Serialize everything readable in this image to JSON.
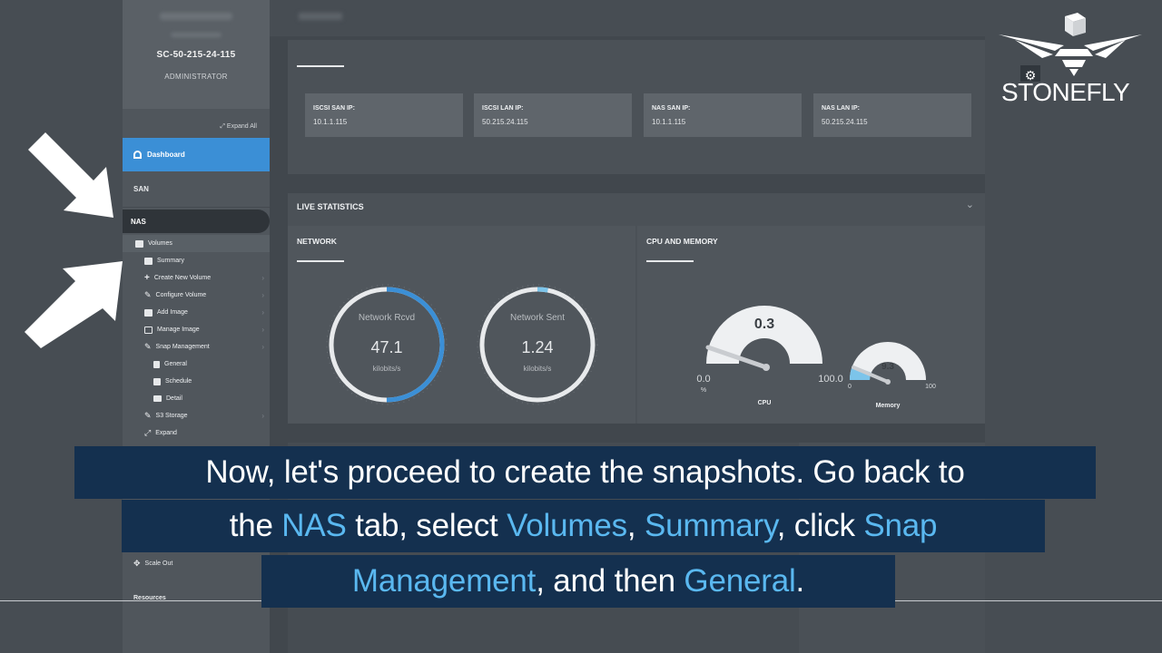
{
  "sidebar": {
    "hostname": "SC-50-215-24-115",
    "role": "ADMINISTRATOR",
    "expand_all": "Expand All",
    "dashboard": "Dashboard",
    "san": "SAN",
    "nas": "NAS",
    "volumes": "Volumes",
    "summary": "Summary",
    "create_new_volume": "Create New Volume",
    "configure_volume": "Configure Volume",
    "add_image": "Add Image",
    "manage_image": "Manage Image",
    "snap_management": "Snap Management",
    "general": "General",
    "schedule": "Schedule",
    "detail": "Detail",
    "s3_storage": "S3 Storage",
    "expand": "Expand",
    "scale_out": "Scale Out",
    "resources": "Resources"
  },
  "ip_boxes": [
    {
      "label": "ISCSI SAN IP:",
      "value": "10.1.1.115"
    },
    {
      "label": "ISCSI LAN IP:",
      "value": "50.215.24.115"
    },
    {
      "label": "NAS SAN IP:",
      "value": "10.1.1.115"
    },
    {
      "label": "NAS LAN IP:",
      "value": "50.215.24.115"
    }
  ],
  "live": {
    "title": "LIVE STATISTICS",
    "collapse_icon": "chevron-down-icon",
    "network": {
      "title": "NETWORK",
      "rcvd": {
        "label": "Network Rcvd",
        "value": "47.1",
        "unit": "kilobits/s",
        "fraction": 0.5
      },
      "sent": {
        "label": "Network Sent",
        "value": "1.24",
        "unit": "kilobits/s",
        "fraction": 0.03
      }
    },
    "cpu_memory": {
      "title": "CPU AND MEMORY",
      "cpu": {
        "label": "CPU",
        "value": "0.3",
        "min": "0.0",
        "max": "100.0",
        "unit": "%"
      },
      "memory": {
        "label": "Memory",
        "value": "9.3",
        "min": "0",
        "max": "100"
      }
    }
  },
  "logo": {
    "text": "STONEFLY",
    "icon": "stonefly-logo-icon"
  },
  "captions": {
    "line1": "Now, let's proceed to create the snapshots. Go back to",
    "line2": {
      "a": "the ",
      "nas": "NAS",
      "b": " tab, select ",
      "volumes": "Volumes",
      "c": ", ",
      "summary": "Summary",
      "d": ", click ",
      "snap": "Snap"
    },
    "line3": {
      "management": "Management",
      "a": ", and then ",
      "general": "General",
      "b": "."
    }
  },
  "colors": {
    "accent": "#3b8fd6",
    "caption_bg": "#14304f",
    "highlight": "#5ab8f0"
  }
}
